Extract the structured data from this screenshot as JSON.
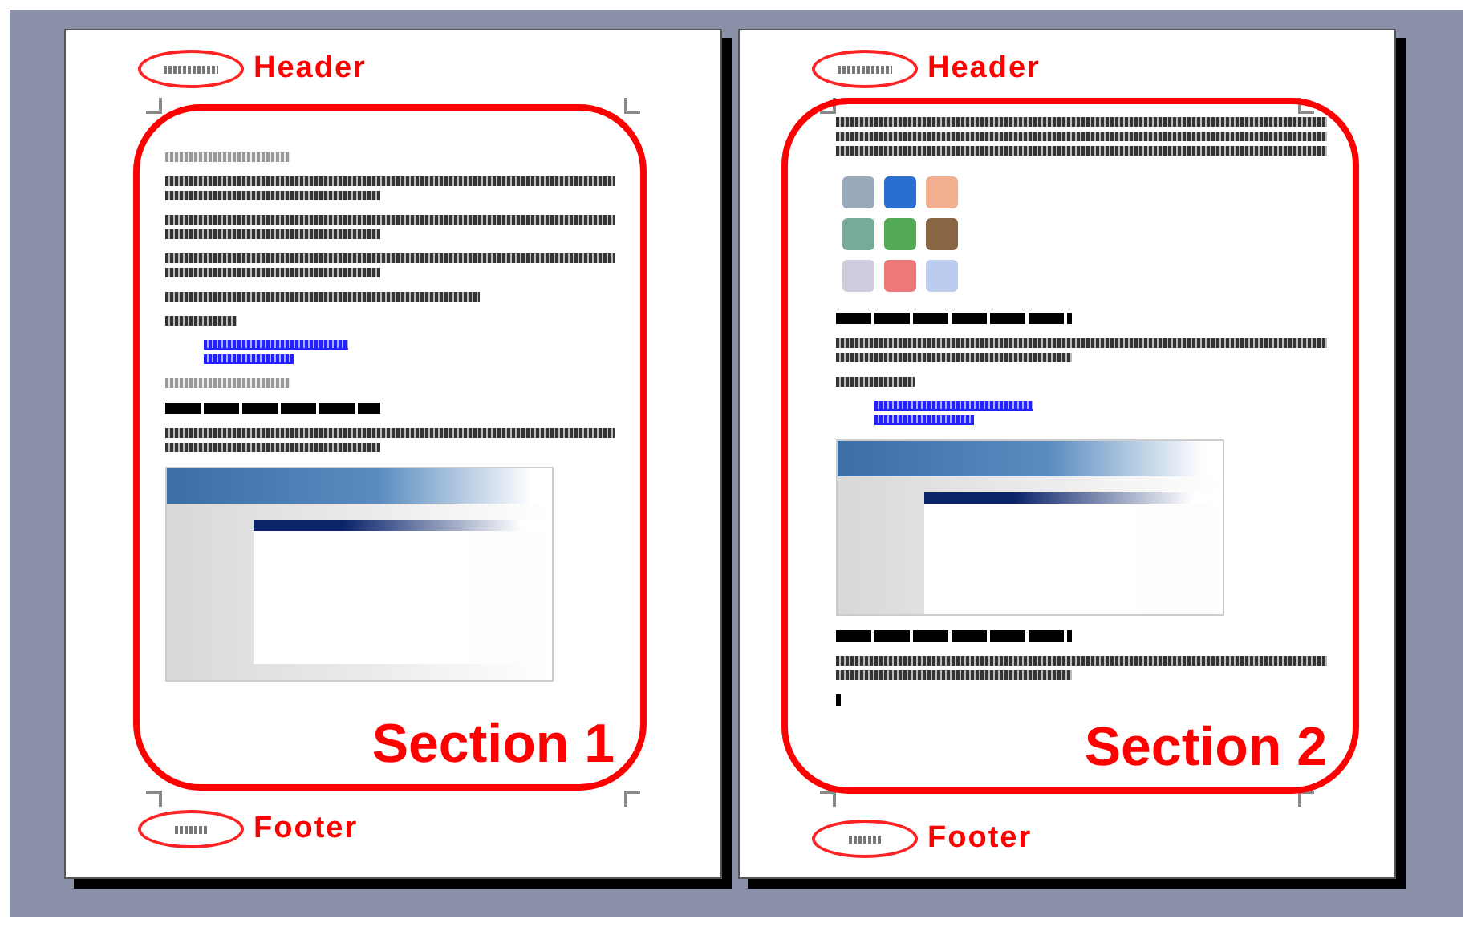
{
  "pages": [
    {
      "header_label": "Header",
      "section_label": "Section 1",
      "footer_label": "Footer",
      "blocks": [
        {
          "kind": "title"
        },
        {
          "kind": "paragraph"
        },
        {
          "kind": "paragraph"
        },
        {
          "kind": "paragraph"
        },
        {
          "kind": "line"
        },
        {
          "kind": "short"
        },
        {
          "kind": "links"
        },
        {
          "kind": "title"
        },
        {
          "kind": "bold"
        },
        {
          "kind": "paragraph"
        },
        {
          "kind": "screenshot"
        }
      ]
    },
    {
      "header_label": "Header",
      "section_label": "Section 2",
      "footer_label": "Footer",
      "blocks": [
        {
          "kind": "long"
        },
        {
          "kind": "icons"
        },
        {
          "kind": "bold"
        },
        {
          "kind": "paragraph"
        },
        {
          "kind": "short"
        },
        {
          "kind": "links"
        },
        {
          "kind": "screenshot"
        },
        {
          "kind": "bold"
        },
        {
          "kind": "paragraph"
        },
        {
          "kind": "cursor"
        }
      ]
    }
  ]
}
